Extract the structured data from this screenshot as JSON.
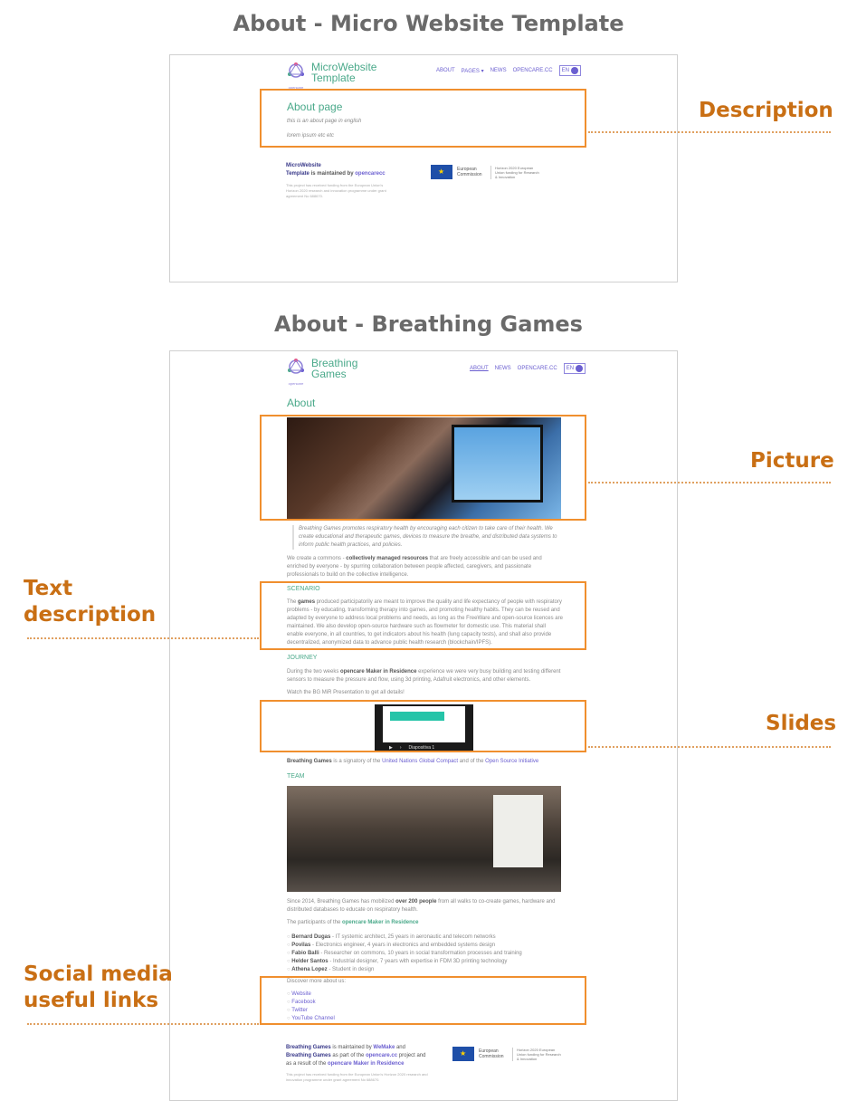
{
  "sections": {
    "micro_title": "About - Micro Website Template",
    "bg_title": "About - Breathing Games"
  },
  "micro": {
    "logo_sub": "opencare",
    "site_name": "MicroWebsite Template",
    "nav": [
      "ABOUT",
      "PAGES ▾",
      "NEWS",
      "OPENCARE.CC"
    ],
    "lang": "EN",
    "page_heading": "About page",
    "intro": "this is an about page in english",
    "lorem": "lorem ipsum etc etc",
    "footer_name": "MicroWebsite",
    "footer_maintained_prefix": "Template",
    "footer_maintained_mid": "is maintained by",
    "footer_maintained_by": "opencarecc",
    "footer_funding": "This project has received funding from the European Union's Horizon 2020 research and innovation programme under grant agreement No 688670.",
    "eu_label": "European Commission",
    "horizon": "Horizon 2020 European Union funding for Research & Innovation"
  },
  "bg": {
    "logo_sub": "opencare",
    "site_name": "Breathing Games",
    "nav": [
      "ABOUT",
      "NEWS",
      "OPENCARE.CC"
    ],
    "lang": "EN",
    "page_heading": "About",
    "quote": "Breathing Games promotes respiratory health by encouraging each citizen to take care of their health. We create educational and therapeutic games, devices to measure the breathe, and distributed data systems to inform public health practices, and policies.",
    "commons_pre": "We create a commons -",
    "commons_bold": "collectively managed resources",
    "commons_post": "that are freely accessible and can be used and enriched by everyone - by spurring collaboration between people affected, caregivers, and passionate professionals to build on the collective intelligence.",
    "scenario_heading": "SCENARIO",
    "scenario_text_pre": "The",
    "scenario_bold": "games",
    "scenario_text": "produced participatorily are meant to improve the quality and life expectancy of people with respiratory problems - by educating, transforming therapy into games, and promoting healthy habits. They can be reused and adapted by everyone to address local problems and needs, as long as the FreeWare and open-source licences are maintained. We also develop open-source hardware such as flowmeter for domestic use. This material shall enable everyone, in all countries, to get indicators about his health (lung capacity tests), and shall also provide decentralized, anonymized data to advance public health research (blockchain/IPFS).",
    "journey_heading": "JOURNEY",
    "journey_pre": "During the two weeks",
    "journey_bold": "opencare Maker in Residence",
    "journey_post": "experience we were very busy building and testing different sensors to measure the pressure and flow, using 3d printing, Adafruit electronics, and other elements.",
    "watch": "Watch the BG MiR Presentation to get all details!",
    "slides_label": "Diapositiva 1",
    "signatory_bold": "Breathing Games",
    "signatory_mid": "is a signatory of the",
    "signatory_link1": "United Nations Global Compact",
    "signatory_and": "and of the",
    "signatory_link2": "Open Source Initiative",
    "team_heading": "TEAM",
    "since_pre": "Since 2014, Breathing Games has mobilized",
    "since_bold": "over 200 people",
    "since_post": "from all walks to co-create games, hardware and distributed databases to educate on respiratory health.",
    "participants_pre": "The participants of the",
    "participants_bold": "opencare Maker in Residence",
    "participants": [
      {
        "name": "Bernard Dugas",
        "desc": "- IT systemic architect, 25 years in aeronautic and telecom networks"
      },
      {
        "name": "Povilas",
        "desc": "- Electronics engineer, 4 years in electronics and embedded systems design"
      },
      {
        "name": "Fabio Balli",
        "desc": "- Researcher on commons, 10 years in social transformation processes and training"
      },
      {
        "name": "Helder Santos",
        "desc": "- Industrial designer, 7 years with expertise in FDM 3D printing technology"
      },
      {
        "name": "Athena Lopez",
        "desc": "- Student in design"
      }
    ],
    "discover": "Discover more about us:",
    "links": [
      "Website",
      "Facebook",
      "Twitter",
      "YouTube Channel"
    ],
    "footer_line1_bold": "Breathing Games",
    "footer_line1_mid": "is maintained by",
    "footer_line1_link": "WeMake",
    "footer_line1_end": "and",
    "footer_line2_bold": "Breathing Games",
    "footer_line2_mid": "as part of the",
    "footer_line2_link": "opencare.cc",
    "footer_line2_end": "project and",
    "footer_line3_pre": "as a result of the",
    "footer_line3_link": "opencare Maker in Residence",
    "footer_funding": "This project has received funding from the European Union's Horizon 2020 research and innovation programme under grant agreement No 688670.",
    "eu_label": "European Commission",
    "horizon": "Horizon 2020 European Union funding for Research & Innovation"
  },
  "callouts": {
    "description": "Description",
    "picture": "Picture",
    "text_desc_1": "Text",
    "text_desc_2": "description",
    "slides": "Slides",
    "social_1": "Social media",
    "social_2": "useful links"
  }
}
